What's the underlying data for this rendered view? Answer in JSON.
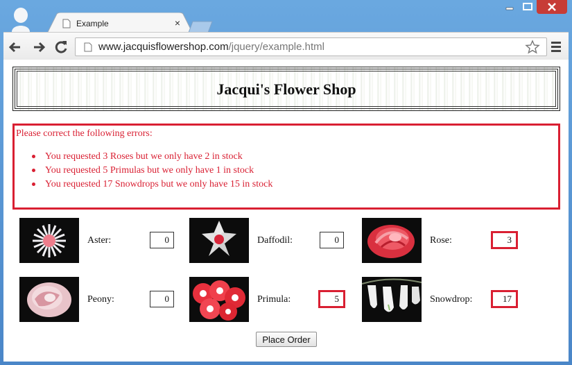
{
  "browser": {
    "tab_title": "Example",
    "tab_close": "×",
    "url_host": "www.jacquisflowershop.com",
    "url_path": "/jquery/example.html"
  },
  "page": {
    "title": "Jacqui's Flower Shop",
    "errors": {
      "intro": "Please correct the following errors:",
      "items": [
        "You requested 3 Roses but we only have 2 in stock",
        "You requested 5 Primulas but we only have 1 in stock",
        "You requested 17 Snowdrops but we only have 15 in stock"
      ]
    },
    "flowers": [
      {
        "label": "Aster:",
        "value": "0",
        "error": false
      },
      {
        "label": "Daffodil:",
        "value": "0",
        "error": false
      },
      {
        "label": "Rose:",
        "value": "3",
        "error": true
      },
      {
        "label": "Peony:",
        "value": "0",
        "error": false
      },
      {
        "label": "Primula:",
        "value": "5",
        "error": true
      },
      {
        "label": "Snowdrop:",
        "value": "17",
        "error": true
      }
    ],
    "order_button": "Place Order"
  },
  "colors": {
    "error": "#d91f32",
    "window_frame": "#5a9ad6"
  }
}
